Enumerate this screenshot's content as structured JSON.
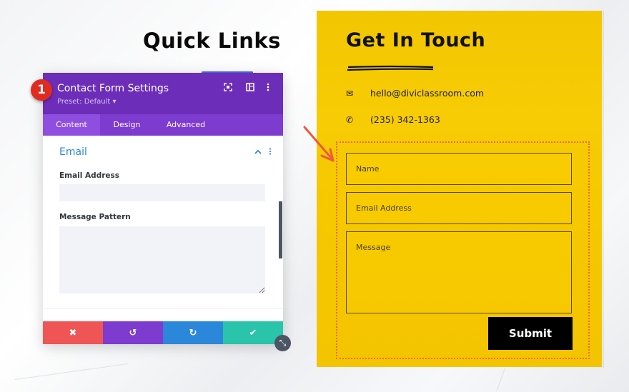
{
  "page": {
    "heading": "Quick Links"
  },
  "annotation": {
    "step_badge": "1"
  },
  "settings_modal": {
    "title": "Contact Form Settings",
    "preset": "Preset: Default ▾",
    "header_icons": [
      "focus-icon",
      "split-view-icon",
      "more-icon"
    ],
    "tabs": [
      {
        "label": "Content",
        "active": true
      },
      {
        "label": "Design",
        "active": false
      },
      {
        "label": "Advanced",
        "active": false
      }
    ],
    "section": {
      "title": "Email",
      "fields": [
        {
          "label": "Email Address",
          "value": ""
        },
        {
          "label": "Message Pattern",
          "value": ""
        }
      ]
    },
    "footer_buttons": [
      {
        "name": "discard",
        "glyph": "✖",
        "color": "#ef5555"
      },
      {
        "name": "undo",
        "glyph": "↺",
        "color": "#7d3bcf"
      },
      {
        "name": "redo",
        "glyph": "↻",
        "color": "#2b87da"
      },
      {
        "name": "save",
        "glyph": "✔",
        "color": "#29c4a9"
      }
    ],
    "resize_glyph": "⤡"
  },
  "contact_card": {
    "title": "Get In Touch",
    "email": "hello@diviclassroom.com",
    "phone": "(235) 342-1363",
    "email_icon_glyph": "✉",
    "phone_icon_glyph": "✆",
    "form": {
      "name_placeholder": "Name",
      "email_placeholder": "Email Address",
      "message_placeholder": "Message",
      "submit_label": "Submit"
    },
    "colors": {
      "card_bg": "#f5c800",
      "highlight_outline": "#f16a2f"
    }
  }
}
